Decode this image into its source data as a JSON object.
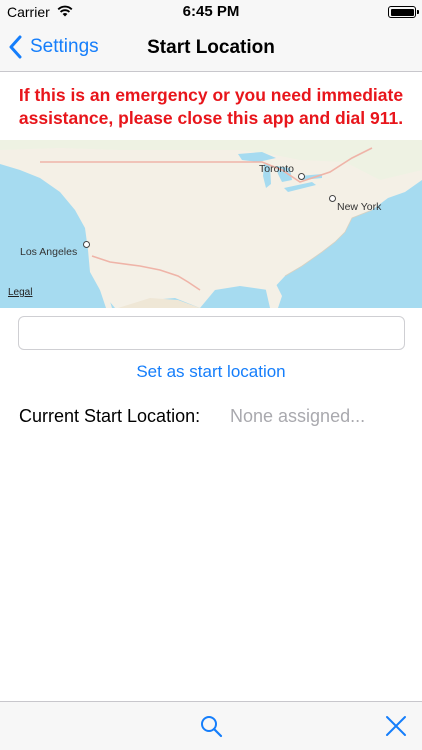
{
  "status_bar": {
    "carrier": "Carrier",
    "time": "6:45 PM",
    "battery_level": 1.0
  },
  "nav": {
    "back_label": "Settings",
    "title": "Start Location"
  },
  "warning": {
    "line1": "If this is an emergency or you need immediate",
    "line2": "assistance, please close this app and dial 911."
  },
  "map": {
    "cities": [
      "Toronto",
      "New York",
      "Los Angeles"
    ],
    "legal": "Legal"
  },
  "location_input": {
    "value": "",
    "placeholder": ""
  },
  "set_start_label": "Set as start location",
  "current": {
    "label": "Current Start Location:",
    "value": "None assigned..."
  },
  "toolbar": {
    "icons": [
      "search-icon",
      "close-icon"
    ]
  },
  "colors": {
    "accent": "#157efb",
    "warning": "#e8151b",
    "placeholder_gray": "#a9a9ae",
    "water": "#a6dbf0",
    "land": "#f4f0e6"
  }
}
